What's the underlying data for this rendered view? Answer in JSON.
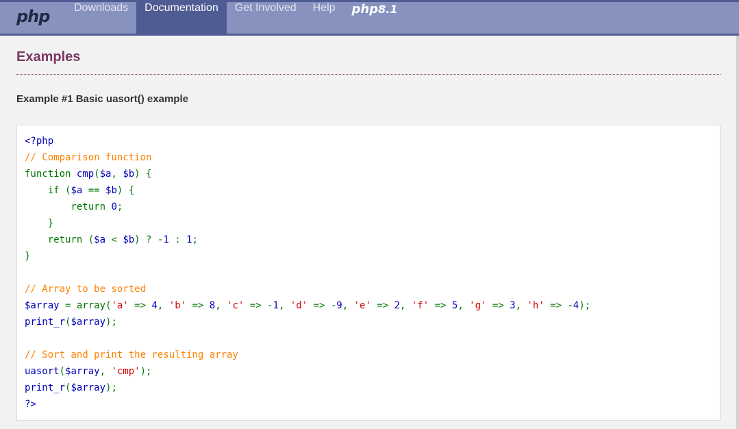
{
  "header": {
    "logo": "php",
    "nav": [
      {
        "label": "Downloads",
        "active": false
      },
      {
        "label": "Documentation",
        "active": true
      },
      {
        "label": "Get Involved",
        "active": false
      },
      {
        "label": "Help",
        "active": false
      }
    ],
    "version_logo": {
      "text": "php",
      "version": "8.1"
    }
  },
  "main": {
    "section_title": "Examples",
    "example_title": "Example #1 Basic uasort() example",
    "code_lines": [
      [
        {
          "t": "<?php",
          "c": "df"
        }
      ],
      [
        {
          "t": "// Comparison function",
          "c": "cm"
        }
      ],
      [
        {
          "t": "function ",
          "c": "kw"
        },
        {
          "t": "cmp",
          "c": "df"
        },
        {
          "t": "(",
          "c": "kw"
        },
        {
          "t": "$a",
          "c": "df"
        },
        {
          "t": ", ",
          "c": "kw"
        },
        {
          "t": "$b",
          "c": "df"
        },
        {
          "t": ") {",
          "c": "kw"
        }
      ],
      [
        {
          "t": "    if (",
          "c": "kw"
        },
        {
          "t": "$a ",
          "c": "df"
        },
        {
          "t": "== ",
          "c": "kw"
        },
        {
          "t": "$b",
          "c": "df"
        },
        {
          "t": ") {",
          "c": "kw"
        }
      ],
      [
        {
          "t": "        return ",
          "c": "kw"
        },
        {
          "t": "0",
          "c": "df"
        },
        {
          "t": ";",
          "c": "kw"
        }
      ],
      [
        {
          "t": "    }",
          "c": "kw"
        }
      ],
      [
        {
          "t": "    return (",
          "c": "kw"
        },
        {
          "t": "$a ",
          "c": "df"
        },
        {
          "t": "< ",
          "c": "kw"
        },
        {
          "t": "$b",
          "c": "df"
        },
        {
          "t": ") ? -",
          "c": "kw"
        },
        {
          "t": "1 ",
          "c": "df"
        },
        {
          "t": ": ",
          "c": "kw"
        },
        {
          "t": "1",
          "c": "df"
        },
        {
          "t": ";",
          "c": "kw"
        }
      ],
      [
        {
          "t": "}",
          "c": "kw"
        }
      ],
      [],
      [
        {
          "t": "// Array to be sorted",
          "c": "cm"
        }
      ],
      [
        {
          "t": "$array ",
          "c": "df"
        },
        {
          "t": "= array(",
          "c": "kw"
        },
        {
          "t": "'a' ",
          "c": "st"
        },
        {
          "t": "=> ",
          "c": "kw"
        },
        {
          "t": "4",
          "c": "df"
        },
        {
          "t": ", ",
          "c": "kw"
        },
        {
          "t": "'b' ",
          "c": "st"
        },
        {
          "t": "=> ",
          "c": "kw"
        },
        {
          "t": "8",
          "c": "df"
        },
        {
          "t": ", ",
          "c": "kw"
        },
        {
          "t": "'c' ",
          "c": "st"
        },
        {
          "t": "=> -",
          "c": "kw"
        },
        {
          "t": "1",
          "c": "df"
        },
        {
          "t": ", ",
          "c": "kw"
        },
        {
          "t": "'d' ",
          "c": "st"
        },
        {
          "t": "=> -",
          "c": "kw"
        },
        {
          "t": "9",
          "c": "df"
        },
        {
          "t": ", ",
          "c": "kw"
        },
        {
          "t": "'e' ",
          "c": "st"
        },
        {
          "t": "=> ",
          "c": "kw"
        },
        {
          "t": "2",
          "c": "df"
        },
        {
          "t": ", ",
          "c": "kw"
        },
        {
          "t": "'f' ",
          "c": "st"
        },
        {
          "t": "=> ",
          "c": "kw"
        },
        {
          "t": "5",
          "c": "df"
        },
        {
          "t": ", ",
          "c": "kw"
        },
        {
          "t": "'g' ",
          "c": "st"
        },
        {
          "t": "=> ",
          "c": "kw"
        },
        {
          "t": "3",
          "c": "df"
        },
        {
          "t": ", ",
          "c": "kw"
        },
        {
          "t": "'h' ",
          "c": "st"
        },
        {
          "t": "=> -",
          "c": "kw"
        },
        {
          "t": "4",
          "c": "df"
        },
        {
          "t": ");",
          "c": "kw"
        }
      ],
      [
        {
          "t": "print_r",
          "c": "df"
        },
        {
          "t": "(",
          "c": "kw"
        },
        {
          "t": "$array",
          "c": "df"
        },
        {
          "t": ");",
          "c": "kw"
        }
      ],
      [],
      [
        {
          "t": "// Sort and print the resulting array",
          "c": "cm"
        }
      ],
      [
        {
          "t": "uasort",
          "c": "df"
        },
        {
          "t": "(",
          "c": "kw"
        },
        {
          "t": "$array",
          "c": "df"
        },
        {
          "t": ", ",
          "c": "kw"
        },
        {
          "t": "'cmp'",
          "c": "st"
        },
        {
          "t": ");",
          "c": "kw"
        }
      ],
      [
        {
          "t": "print_r",
          "c": "df"
        },
        {
          "t": "(",
          "c": "kw"
        },
        {
          "t": "$array",
          "c": "df"
        },
        {
          "t": ");",
          "c": "kw"
        }
      ],
      [
        {
          "t": "?>",
          "c": "df"
        }
      ]
    ]
  },
  "colors": {
    "header_bg": "#8892bf",
    "header_active": "#4f5b93",
    "title": "#793862",
    "keyword": "#007700",
    "default": "#0000bb",
    "comment": "#ff8000",
    "string": "#dd0000"
  }
}
